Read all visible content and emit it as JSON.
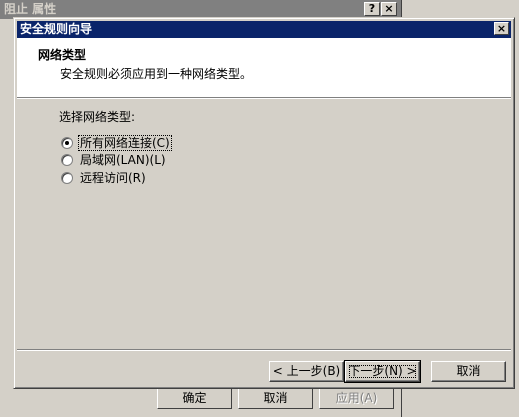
{
  "background_window": {
    "title": "阻止 属性",
    "help_glyph": "?",
    "close_glyph": "×",
    "buttons": {
      "ok": "确定",
      "cancel": "取消",
      "apply": "应用(A)"
    }
  },
  "wizard": {
    "title": "安全规则向导",
    "close_glyph": "×",
    "header": {
      "title": "网络类型",
      "subtitle": "安全规则必须应用到一种网络类型。"
    },
    "prompt": "选择网络类型:",
    "options": [
      {
        "label": "所有网络连接(C)",
        "selected": true
      },
      {
        "label": "局域网(LAN)(L)",
        "selected": false
      },
      {
        "label": "远程访问(R)",
        "selected": false
      }
    ],
    "buttons": {
      "back": "< 上一步(B)",
      "next": "下一步(N) >",
      "cancel": "取消"
    }
  }
}
